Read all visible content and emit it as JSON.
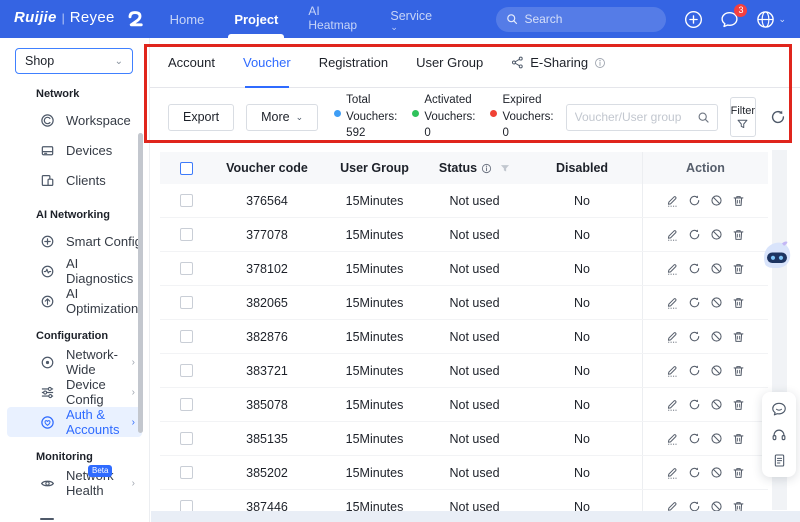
{
  "colors": {
    "navbar_bg": "#3564e3",
    "accent_blue": "#2f6bff",
    "annotation_red": "#e0251c",
    "notification_badge_red": "#f53f3f"
  },
  "navbar": {
    "brand": "Ruijie",
    "divider": "|",
    "product": "Reyee",
    "items": [
      {
        "label": "Home"
      },
      {
        "label": "Project"
      },
      {
        "label": "AI Heatmap"
      },
      {
        "label": "Service"
      }
    ],
    "active_item": "Project",
    "search_placeholder": "Search",
    "notification_count": "3"
  },
  "sidebar": {
    "org_selector_value": "Shop",
    "active_item": "Auth & Accounts",
    "sections": [
      {
        "label": "Network",
        "items": [
          {
            "label": "Workspace"
          },
          {
            "label": "Devices"
          },
          {
            "label": "Clients"
          }
        ]
      },
      {
        "label": "AI Networking",
        "items": [
          {
            "label": "Smart Config"
          },
          {
            "label": "AI Diagnostics"
          },
          {
            "label": "AI Optimization"
          }
        ]
      },
      {
        "label": "Configuration",
        "items": [
          {
            "label": "Network-Wide"
          },
          {
            "label": "Device Config"
          },
          {
            "label": "Auth & Accounts"
          }
        ]
      },
      {
        "label": "Monitoring",
        "items": [
          {
            "label": "Network Health",
            "badge": "Beta"
          }
        ]
      }
    ]
  },
  "tabs": {
    "active_tab": "Voucher",
    "items": [
      {
        "label": "Account"
      },
      {
        "label": "Voucher"
      },
      {
        "label": "Registration"
      },
      {
        "label": "User Group"
      },
      {
        "label": "E-Sharing"
      }
    ]
  },
  "toolbar": {
    "export_label": "Export",
    "more_label": "More",
    "stats": [
      {
        "label_line1": "Total",
        "label_line2": "Vouchers:",
        "value": "592",
        "dot_color": "#3e9df5"
      },
      {
        "label_line1": "Activated",
        "label_line2": "Vouchers:",
        "value": "0",
        "dot_color": "#2fc25b"
      },
      {
        "label_line1": "Expired",
        "label_line2": "Vouchers:",
        "value": "0",
        "dot_color": "#f04134"
      }
    ],
    "search_placeholder": "Voucher/User group",
    "filter_label": "Filter"
  },
  "table": {
    "headers": {
      "code": "Voucher code",
      "group": "User Group",
      "status": "Status",
      "disabled": "Disabled",
      "action": "Action"
    },
    "rows": [
      {
        "code": "376564",
        "group": "15Minutes",
        "status": "Not used",
        "disabled": "No"
      },
      {
        "code": "377078",
        "group": "15Minutes",
        "status": "Not used",
        "disabled": "No"
      },
      {
        "code": "378102",
        "group": "15Minutes",
        "status": "Not used",
        "disabled": "No"
      },
      {
        "code": "382065",
        "group": "15Minutes",
        "status": "Not used",
        "disabled": "No"
      },
      {
        "code": "382876",
        "group": "15Minutes",
        "status": "Not used",
        "disabled": "No"
      },
      {
        "code": "383721",
        "group": "15Minutes",
        "status": "Not used",
        "disabled": "No"
      },
      {
        "code": "385078",
        "group": "15Minutes",
        "status": "Not used",
        "disabled": "No"
      },
      {
        "code": "385135",
        "group": "15Minutes",
        "status": "Not used",
        "disabled": "No"
      },
      {
        "code": "385202",
        "group": "15Minutes",
        "status": "Not used",
        "disabled": "No"
      },
      {
        "code": "387446",
        "group": "15Minutes",
        "status": "Not used",
        "disabled": "No"
      }
    ]
  }
}
